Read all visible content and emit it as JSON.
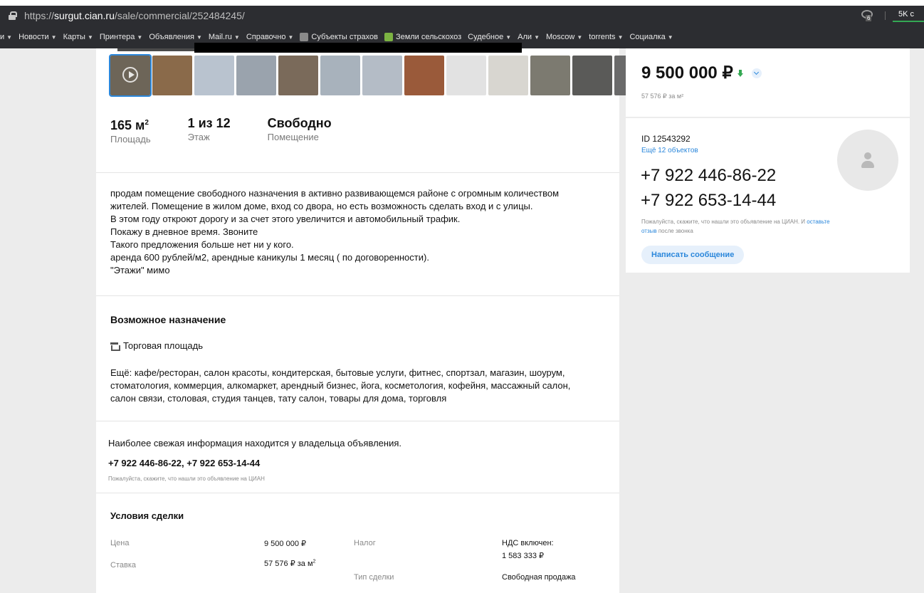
{
  "browser": {
    "url_prefix": "https://",
    "url_host": "surgut.cian.ru",
    "url_path": "/sale/commercial/252484245/",
    "ext_badge": "6",
    "chat_label": "5K c"
  },
  "bookmarks": [
    {
      "label": "и",
      "caret": true
    },
    {
      "label": "Новости",
      "caret": true
    },
    {
      "label": "Карты",
      "caret": true
    },
    {
      "label": "Принтера",
      "caret": true
    },
    {
      "label": "Объявления",
      "caret": true
    },
    {
      "label": "Mail.ru",
      "caret": true
    },
    {
      "label": "Справочно",
      "caret": true
    },
    {
      "label": "Субъекты страхов",
      "caret": false,
      "icon": "emblem-icon"
    },
    {
      "label": "Земли сельскохоз",
      "caret": false,
      "icon": "map-pin-icon"
    },
    {
      "label": "Судебное",
      "caret": true
    },
    {
      "label": "Али",
      "caret": true
    },
    {
      "label": "Moscow",
      "caret": true
    },
    {
      "label": "torrents",
      "caret": true
    },
    {
      "label": "Социалка",
      "caret": true
    }
  ],
  "gallery": {
    "thumb_colors": [
      "#6d6558",
      "#8a6a4a",
      "#b9c3cf",
      "#9aa3ad",
      "#7a6a5a",
      "#a8b2bc",
      "#b4bcc6",
      "#9a5a3a",
      "#e2e2e2",
      "#d8d6d0",
      "#7c7a70",
      "#5a5a58",
      "#6a6a6a"
    ]
  },
  "facts": [
    {
      "value": "165 м",
      "sup": "2",
      "label": "Площадь"
    },
    {
      "value": "1 из 12",
      "sup": "",
      "label": "Этаж"
    },
    {
      "value": "Свободно",
      "sup": "",
      "label": "Помещение"
    }
  ],
  "description": [
    "продам помещение свободного назначения в активно развивающемся районе с огромным количеством",
    "жителей. Помещение в жилом доме, вход со двора, но есть возможность сделать вход и с улицы.",
    "В этом году откроют дорогу и за счет этого увеличится и автомобильный трафик.",
    "Покажу в дневное время. Звоните",
    "Такого предложения больше нет ни у кого.",
    "аренда 600 рублей/м2, арендные каникулы 1 месяц ( по договоренности).",
    "\"Этажи\" мимо"
  ],
  "purpose": {
    "title": "Возможное назначение",
    "main": "Торговая площадь",
    "also_lines": [
      "Ещё: кафе/ресторан, салон красоты, кондитерская, бытовые услуги, фитнес, спортзал, магазин, шоурум,",
      "стоматология, коммерция, алкомаркет, арендный бизнес, йога, косметология, кофейня, массажный салон,",
      "салон связи, столовая, студия танцев, тату салон, товары для дома, торговля"
    ]
  },
  "contact_block": {
    "fresh": "Наиболее свежая информация находится у владельца объявления.",
    "phones": "+7 922 446-86-22, +7 922 653-14-44",
    "note": "Пожалуйста, скажите, что нашли это объявление на ЦИАН"
  },
  "deal": {
    "title": "Условия сделки",
    "price_label": "Цена",
    "price_value": "9 500 000 ₽",
    "rate_label": "Ставка",
    "rate_value": "57 576 ₽ за м",
    "rate_sup": "2",
    "tax_label": "Налог",
    "tax_value_1": "НДС включен:",
    "tax_value_2": "1 583 333 ₽",
    "type_label": "Тип сделки",
    "type_value": "Свободная продажа"
  },
  "price_card": {
    "price": "9 500 000 ₽",
    "per_m2": "57 576 ₽ за м²"
  },
  "agent": {
    "id": "ID 12543292",
    "more": "Ещё 12 объектов",
    "phone1": "+7 922 446-86-22",
    "phone2": "+7 922 653-14-44",
    "note_a": "Пожалуйста, скажите, что нашли это объявление на ЦИАН. И ",
    "note_link": "оставьте отзыв",
    "note_b": " после звонка",
    "message_button": "Написать сообщение"
  }
}
